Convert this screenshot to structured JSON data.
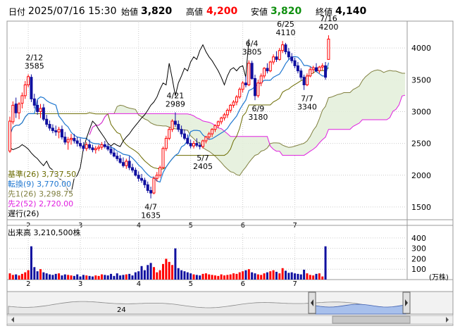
{
  "header": {
    "date_label": "日付",
    "datetime": "2025/07/16 15:30",
    "open_label": "始値",
    "open": "3,820",
    "high_label": "高値",
    "high": "4,200",
    "low_label": "安値",
    "low": "3,820",
    "close_label": "終値",
    "close": "4,140"
  },
  "legend": [
    {
      "label": "基準(26)",
      "value": "3,737.50",
      "color": "#6b6b00"
    },
    {
      "label": "転換(9)",
      "value": "3,770.00",
      "color": "#1f77d0"
    },
    {
      "label": "先1(26)",
      "value": "3,298.75",
      "color": "#808040"
    },
    {
      "label": "先2(52)",
      "value": "2,720.00",
      "color": "#e020e0"
    },
    {
      "label": "遅行(26)",
      "value": "",
      "color": "#000000"
    }
  ],
  "volume_title": "出来高",
  "volume_value": "3,210,500株",
  "volume_unit": "(万株)",
  "navigator_label": "24",
  "colors": {
    "up": "#ff0000",
    "down": "#1010a0",
    "kijun": "#6b6b00",
    "tenkan": "#1f77d0",
    "senkou1": "#808040",
    "senkou2": "#e020e0",
    "chikou": "#000000",
    "cloud": "#e4f0dc",
    "grid": "#cccccc",
    "navigator_fill": "#a8c0ec",
    "navigator_bg": "#e8e8e8"
  },
  "chart_data": [
    {
      "type": "candlestick",
      "ylim": [
        1300,
        4400
      ],
      "y_ticks": [
        1500,
        2000,
        2500,
        3000,
        3500,
        4000
      ],
      "month_ticks": [
        {
          "label": "2",
          "day": 6
        },
        {
          "label": "3",
          "day": 23
        },
        {
          "label": "4",
          "day": 42
        },
        {
          "label": "5",
          "day": 59
        },
        {
          "label": "6",
          "day": 76
        },
        {
          "label": "7",
          "day": 93
        }
      ],
      "grid": true,
      "annotations": [
        {
          "date": "2/12",
          "value": "3585",
          "day": 8,
          "price": 3585,
          "pos": "above"
        },
        {
          "date": "4/7",
          "value": "1635",
          "day": 46,
          "price": 1635,
          "pos": "below"
        },
        {
          "date": "4/21",
          "value": "2989",
          "day": 54,
          "price": 2989,
          "pos": "above"
        },
        {
          "date": "5/7",
          "value": "2405",
          "day": 63,
          "price": 2405,
          "pos": "below"
        },
        {
          "date": "6/4",
          "value": "3805",
          "day": 79,
          "price": 3805,
          "pos": "above"
        },
        {
          "date": "6/9",
          "value": "3180",
          "day": 81,
          "price": 3180,
          "pos": "below"
        },
        {
          "date": "6/25",
          "value": "4110",
          "day": 90,
          "price": 4110,
          "pos": "above"
        },
        {
          "date": "7/7",
          "value": "3340",
          "day": 97,
          "price": 3340,
          "pos": "below"
        },
        {
          "date": "7/16",
          "value": "4200",
          "day": 104,
          "price": 4200,
          "pos": "above"
        }
      ],
      "ohlc": [
        [
          2380,
          2920,
          2350,
          2850
        ],
        [
          2840,
          3160,
          2800,
          3100
        ],
        [
          3120,
          3220,
          2900,
          2980
        ],
        [
          2980,
          3150,
          2880,
          3120
        ],
        [
          3130,
          3300,
          3050,
          3250
        ],
        [
          3250,
          3480,
          3200,
          3420
        ],
        [
          3420,
          3585,
          3380,
          3550
        ],
        [
          3540,
          3585,
          3150,
          3200
        ],
        [
          3200,
          3280,
          3050,
          3100
        ],
        [
          3100,
          3180,
          2950,
          3000
        ],
        [
          3000,
          3120,
          2900,
          3050
        ],
        [
          3060,
          3120,
          2850,
          2880
        ],
        [
          2880,
          2950,
          2760,
          2800
        ],
        [
          2800,
          2860,
          2700,
          2740
        ],
        [
          2740,
          2800,
          2660,
          2700
        ],
        [
          2700,
          2780,
          2620,
          2680
        ],
        [
          2680,
          2760,
          2580,
          2720
        ],
        [
          2720,
          2780,
          2560,
          2600
        ],
        [
          2600,
          2680,
          2480,
          2520
        ],
        [
          2520,
          2600,
          2400,
          2560
        ],
        [
          2560,
          2650,
          2480,
          2580
        ],
        [
          2580,
          2650,
          2500,
          2540
        ],
        [
          2540,
          2600,
          2450,
          2500
        ],
        [
          2500,
          2580,
          2420,
          2460
        ],
        [
          2460,
          2520,
          2380,
          2420
        ],
        [
          2420,
          2520,
          2380,
          2480
        ],
        [
          2480,
          2560,
          2400,
          2430
        ],
        [
          2430,
          2480,
          2360,
          2400
        ],
        [
          2400,
          2460,
          2340,
          2420
        ],
        [
          2420,
          2480,
          2380,
          2440
        ],
        [
          2440,
          2520,
          2400,
          2480
        ],
        [
          2480,
          2540,
          2420,
          2450
        ],
        [
          2450,
          2500,
          2380,
          2410
        ],
        [
          2410,
          2460,
          2320,
          2350
        ],
        [
          2350,
          2420,
          2280,
          2300
        ],
        [
          2300,
          2360,
          2220,
          2260
        ],
        [
          2260,
          2320,
          2180,
          2200
        ],
        [
          2200,
          2280,
          2120,
          2150
        ],
        [
          2150,
          2260,
          2100,
          2220
        ],
        [
          2220,
          2300,
          2080,
          2120
        ],
        [
          2120,
          2180,
          2040,
          2080
        ],
        [
          2080,
          2120,
          1980,
          2000
        ],
        [
          2000,
          2060,
          1900,
          1950
        ],
        [
          1950,
          2020,
          1880,
          1920
        ],
        [
          1920,
          1960,
          1800,
          1850
        ],
        [
          1850,
          1900,
          1720,
          1760
        ],
        [
          1760,
          1820,
          1635,
          1720
        ],
        [
          1720,
          1980,
          1700,
          1950
        ],
        [
          1950,
          2050,
          1900,
          2000
        ],
        [
          2000,
          2150,
          1960,
          2120
        ],
        [
          2120,
          2450,
          2100,
          2420
        ],
        [
          2420,
          2620,
          2380,
          2580
        ],
        [
          2580,
          2760,
          2550,
          2720
        ],
        [
          2720,
          2880,
          2680,
          2850
        ],
        [
          2850,
          2989,
          2760,
          2800
        ],
        [
          2800,
          2860,
          2680,
          2720
        ],
        [
          2720,
          2780,
          2600,
          2650
        ],
        [
          2650,
          2720,
          2550,
          2580
        ],
        [
          2580,
          2640,
          2480,
          2500
        ],
        [
          2500,
          2560,
          2420,
          2460
        ],
        [
          2460,
          2540,
          2420,
          2500
        ],
        [
          2500,
          2580,
          2440,
          2470
        ],
        [
          2470,
          2520,
          2405,
          2450
        ],
        [
          2450,
          2560,
          2420,
          2540
        ],
        [
          2540,
          2620,
          2500,
          2600
        ],
        [
          2600,
          2680,
          2560,
          2650
        ],
        [
          2650,
          2740,
          2600,
          2720
        ],
        [
          2720,
          2800,
          2680,
          2780
        ],
        [
          2780,
          2860,
          2740,
          2840
        ],
        [
          2840,
          2920,
          2800,
          2900
        ],
        [
          2900,
          2980,
          2860,
          2950
        ],
        [
          2950,
          3050,
          2900,
          3020
        ],
        [
          3020,
          3120,
          2980,
          3100
        ],
        [
          3100,
          3180,
          3060,
          3150
        ],
        [
          3150,
          3260,
          3100,
          3230
        ],
        [
          3230,
          3380,
          3200,
          3350
        ],
        [
          3350,
          3480,
          3300,
          3450
        ],
        [
          3450,
          3560,
          3380,
          3420
        ],
        [
          3420,
          3805,
          3400,
          3760
        ],
        [
          3760,
          3800,
          3500,
          3520
        ],
        [
          3520,
          3580,
          3180,
          3250
        ],
        [
          3250,
          3500,
          3220,
          3450
        ],
        [
          3450,
          3600,
          3400,
          3560
        ],
        [
          3560,
          3700,
          3520,
          3680
        ],
        [
          3680,
          3760,
          3600,
          3640
        ],
        [
          3640,
          3800,
          3620,
          3780
        ],
        [
          3780,
          3900,
          3740,
          3860
        ],
        [
          3860,
          3950,
          3780,
          3820
        ],
        [
          3820,
          4000,
          3800,
          3960
        ],
        [
          3960,
          4110,
          3920,
          4050
        ],
        [
          4050,
          4080,
          3900,
          3940
        ],
        [
          3940,
          4000,
          3820,
          3860
        ],
        [
          3860,
          3920,
          3760,
          3800
        ],
        [
          3800,
          3850,
          3680,
          3720
        ],
        [
          3720,
          3780,
          3600,
          3640
        ],
        [
          3640,
          3680,
          3500,
          3540
        ],
        [
          3540,
          3580,
          3340,
          3420
        ],
        [
          3420,
          3600,
          3400,
          3560
        ],
        [
          3560,
          3700,
          3540,
          3660
        ],
        [
          3660,
          3720,
          3600,
          3690
        ],
        [
          3690,
          3760,
          3620,
          3640
        ],
        [
          3640,
          3720,
          3600,
          3700
        ],
        [
          3700,
          3760,
          3650,
          3720
        ],
        [
          3720,
          3780,
          3500,
          3540
        ],
        [
          3820,
          4200,
          3820,
          4140
        ]
      ],
      "volume": [
        60,
        45,
        50,
        40,
        55,
        70,
        90,
        320,
        120,
        80,
        100,
        70,
        60,
        50,
        45,
        55,
        60,
        40,
        50,
        45,
        40,
        35,
        50,
        30,
        45,
        40,
        35,
        30,
        40,
        35,
        50,
        45,
        40,
        55,
        35,
        60,
        40,
        45,
        50,
        55,
        40,
        70,
        80,
        130,
        90,
        140,
        160,
        120,
        70,
        90,
        150,
        200,
        170,
        140,
        300,
        110,
        90,
        80,
        70,
        60,
        50,
        45,
        40,
        55,
        60,
        50,
        45,
        40,
        35,
        50,
        40,
        45,
        50,
        60,
        55,
        70,
        80,
        90,
        100,
        70,
        60,
        50,
        45,
        60,
        70,
        80,
        90,
        75,
        60,
        110,
        85,
        65,
        70,
        60,
        55,
        50,
        95,
        60,
        45,
        40,
        55,
        60,
        30,
        320
      ]
    }
  ]
}
